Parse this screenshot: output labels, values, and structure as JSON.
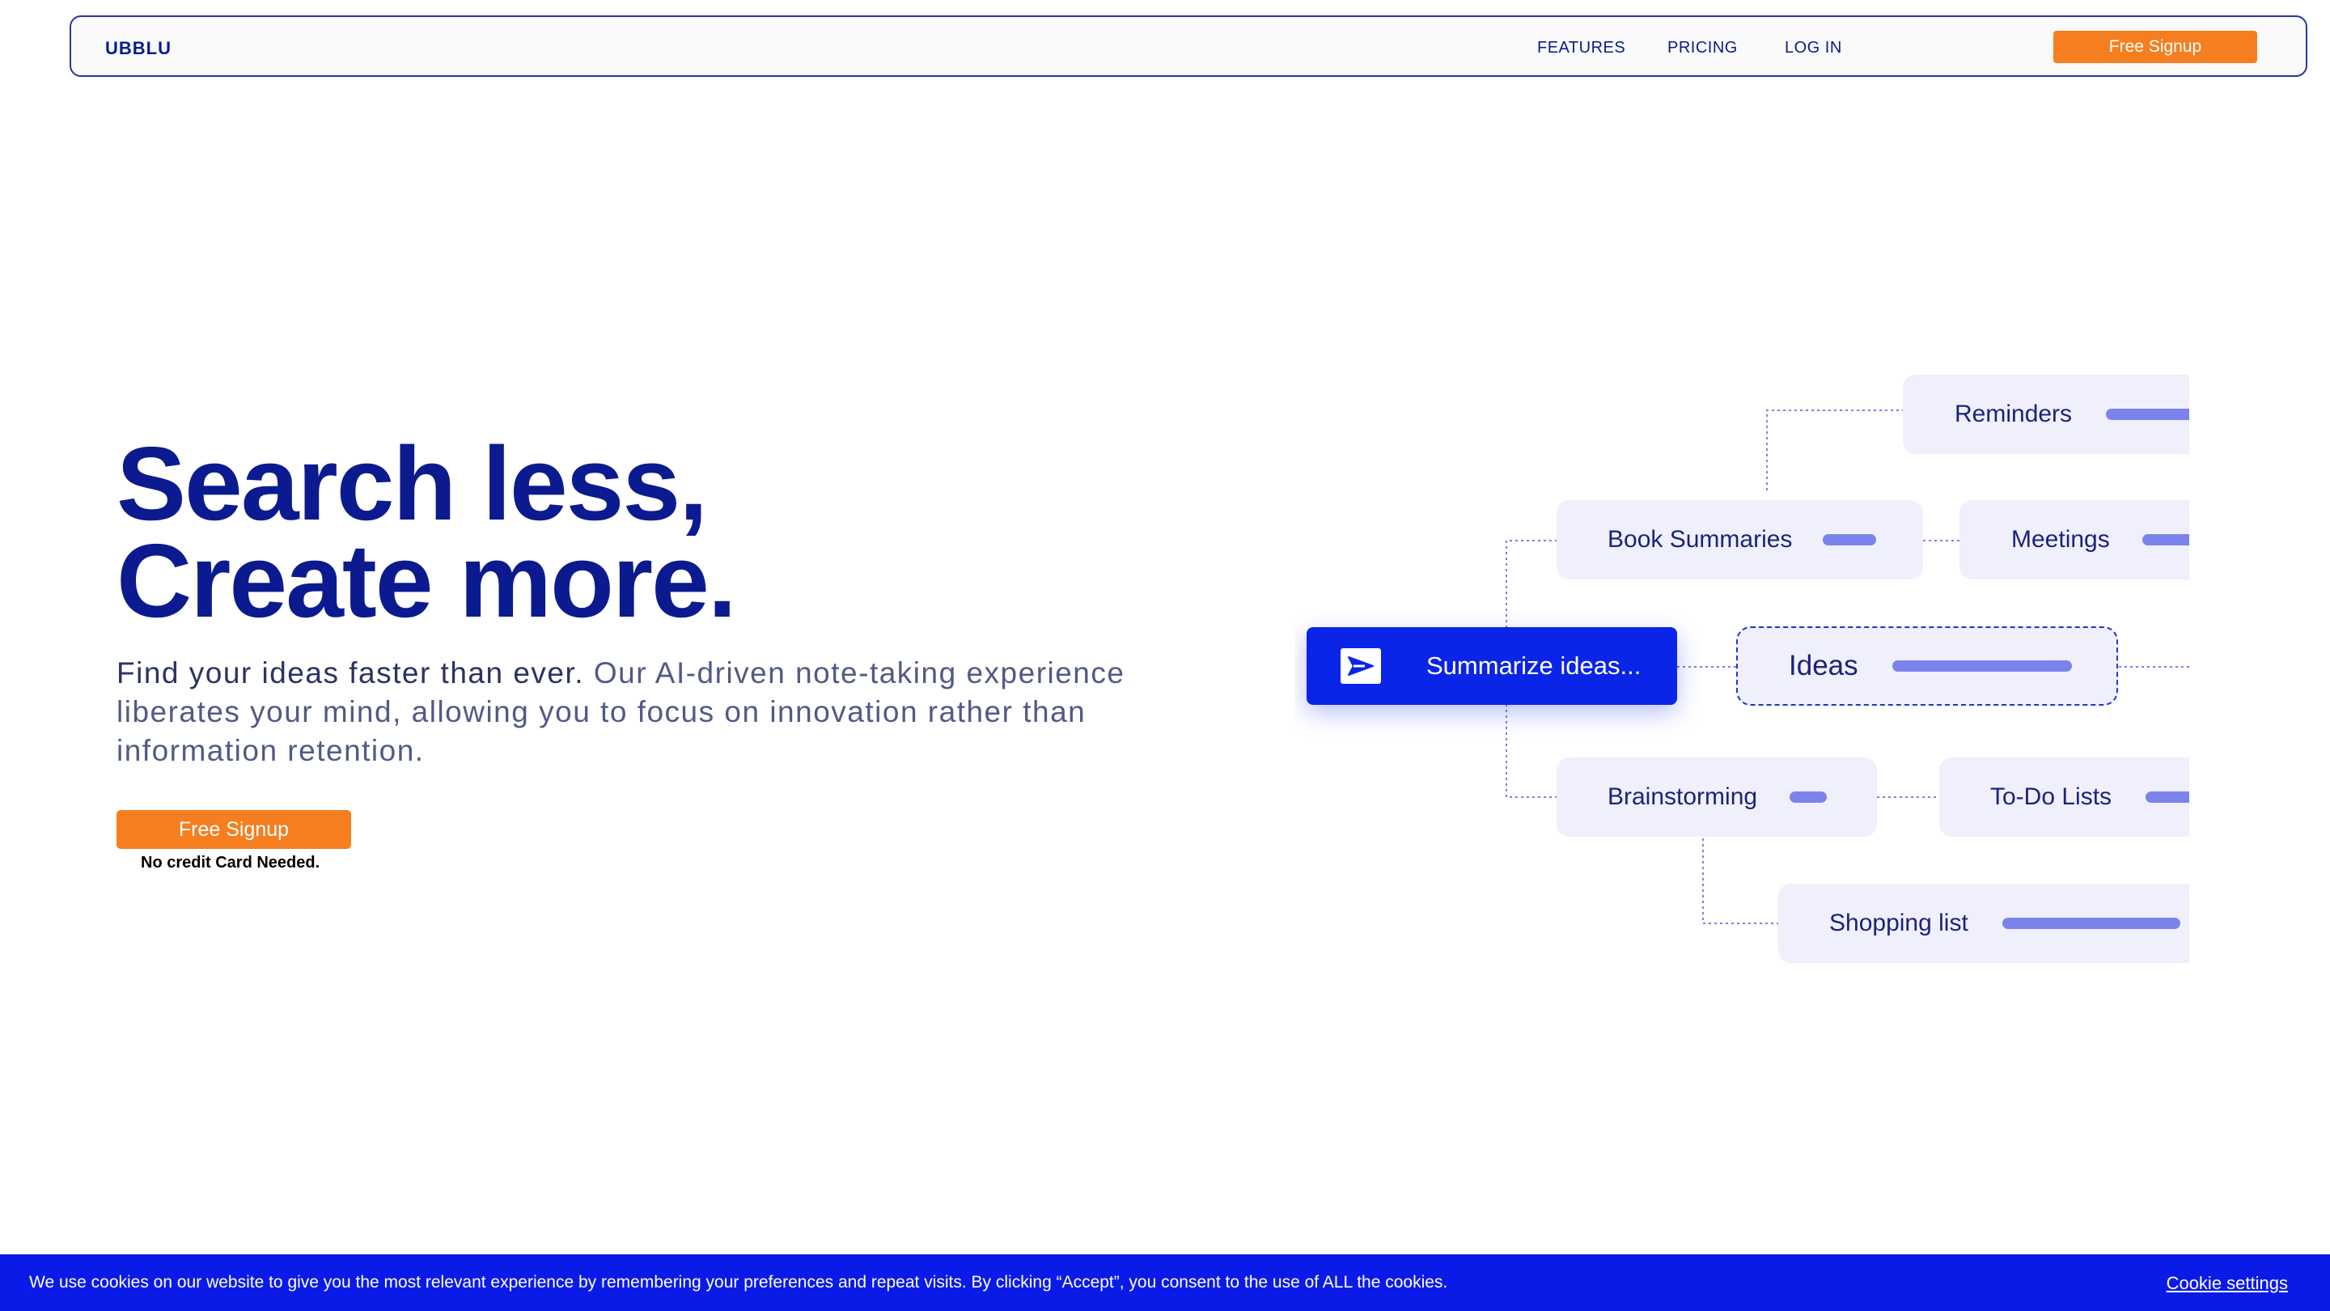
{
  "nav": {
    "logo": "UBBLU",
    "links": [
      "FEATURES",
      "PRICING",
      "LOG IN"
    ],
    "cta": "Free Signup"
  },
  "hero": {
    "title_line1": "Search less,",
    "title_line2": "Create more.",
    "subtitle_strong": "Find your ideas faster than ever.",
    "subtitle_rest": " Our AI-driven note-taking experience liberates your mind, allowing you to focus on innovation rather than information retention.",
    "cta": "Free Signup",
    "note": "No credit Card Needed."
  },
  "diagram": {
    "summarize_button": "Summarize ideas...",
    "cards": {
      "reminders": "Reminders",
      "book_summaries": "Book Summaries",
      "meetings": "Meetings",
      "ideas": "Ideas",
      "brainstorming": "Brainstorming",
      "todo": "To-Do Lists",
      "shopping": "Shopping list"
    }
  },
  "cookie": {
    "text": "We use cookies on our website to give you the most relevant experience by remembering your preferences and repeat visits. By clicking “Accept”, you consent to the use of ALL the cookies.",
    "settings": "Cookie settings"
  },
  "colors": {
    "brand_navy": "#0b1b8f",
    "accent_orange": "#f57f20",
    "brand_blue": "#0a24e8",
    "card_bg": "#eff0fc",
    "pill": "#7b83eb"
  }
}
